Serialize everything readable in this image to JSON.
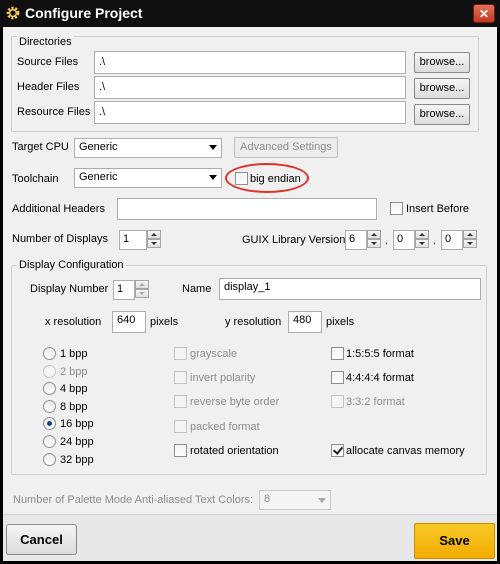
{
  "window": {
    "title": "Configure Project",
    "close_glyph": "✕"
  },
  "directories": {
    "legend": "Directories",
    "rows": [
      {
        "label": "Source Files",
        "value": ".\\",
        "button": "browse..."
      },
      {
        "label": "Header Files",
        "value": ".\\",
        "button": "browse..."
      },
      {
        "label": "Resource Files",
        "value": ".\\",
        "button": "browse..."
      }
    ]
  },
  "target_cpu": {
    "label": "Target CPU",
    "value": "Generic",
    "advanced_button": "Advanced Settings"
  },
  "toolchain": {
    "label": "Toolchain",
    "value": "Generic",
    "big_endian_label": "big endian",
    "highlight_color": "#e0312a"
  },
  "additional_headers": {
    "label": "Additional Headers",
    "value": "",
    "insert_before_label": "Insert Before"
  },
  "displays": {
    "count_label": "Number of Displays",
    "count_value": "1",
    "guix_label": "GUIX Library Version",
    "major": "6",
    "minor": "0",
    "patch": "0",
    "sep1": ".",
    "sep2": "."
  },
  "display_config": {
    "legend": "Display Configuration",
    "number_label": "Display Number",
    "number_value": "1",
    "name_label": "Name",
    "name_value": "display_1",
    "xres_label": "x resolution",
    "xres_value": "640",
    "xres_unit": "pixels",
    "yres_label": "y resolution",
    "yres_value": "480",
    "yres_unit": "pixels",
    "bpp": [
      {
        "label": "1 bpp",
        "enabled": true,
        "selected": false
      },
      {
        "label": "2 bpp",
        "enabled": false,
        "selected": false
      },
      {
        "label": "4 bpp",
        "enabled": true,
        "selected": false
      },
      {
        "label": "8 bpp",
        "enabled": true,
        "selected": false
      },
      {
        "label": "16 bpp",
        "enabled": true,
        "selected": true
      },
      {
        "label": "24 bpp",
        "enabled": true,
        "selected": false
      },
      {
        "label": "32 bpp",
        "enabled": true,
        "selected": false
      }
    ],
    "options": [
      {
        "label": "grayscale",
        "enabled": false,
        "checked": false
      },
      {
        "label": "invert polarity",
        "enabled": false,
        "checked": false
      },
      {
        "label": "reverse byte order",
        "enabled": false,
        "checked": false
      },
      {
        "label": "packed format",
        "enabled": false,
        "checked": false
      },
      {
        "label": "rotated orientation",
        "enabled": true,
        "checked": false
      }
    ],
    "formats": [
      {
        "label": "1:5:5:5 format",
        "enabled": true,
        "checked": false
      },
      {
        "label": "4:4:4:4 format",
        "enabled": true,
        "checked": false
      },
      {
        "label": "3:3:2 format",
        "enabled": false,
        "checked": false
      },
      {
        "label": "allocate canvas memory",
        "enabled": true,
        "checked": true
      }
    ]
  },
  "palette": {
    "label": "Number of Palette Mode Anti-aliased Text Colors:",
    "value": "8"
  },
  "footer": {
    "cancel": "Cancel",
    "save": "Save",
    "save_color": "#f5b800"
  },
  "icons": {
    "title": "gear-icon",
    "close": "close-icon",
    "dropdown": "chevron-down-icon"
  }
}
